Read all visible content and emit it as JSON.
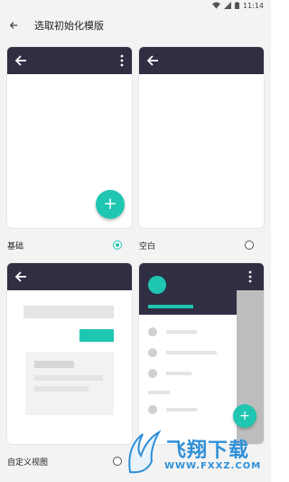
{
  "status_bar": {
    "time": "11:14"
  },
  "app_bar": {
    "title": "选取初始化模版"
  },
  "templates": [
    {
      "label": "基础",
      "selected": true
    },
    {
      "label": "空白",
      "selected": false
    },
    {
      "label": "自定义视图",
      "selected": false
    },
    {
      "label": "",
      "selected": false
    }
  ],
  "fab": {
    "symbol": "+"
  },
  "watermark": {
    "title": "飞翔下载",
    "url": "WWW.FXXZ.COM"
  },
  "colors": {
    "accent": "#1fc6b2",
    "toolbar": "#2f2e42",
    "background": "#f3f3f3"
  },
  "icons": [
    "back-arrow-icon",
    "more-vert-icon",
    "add-icon",
    "wifi-icon",
    "signal-icon",
    "battery-icon"
  ]
}
